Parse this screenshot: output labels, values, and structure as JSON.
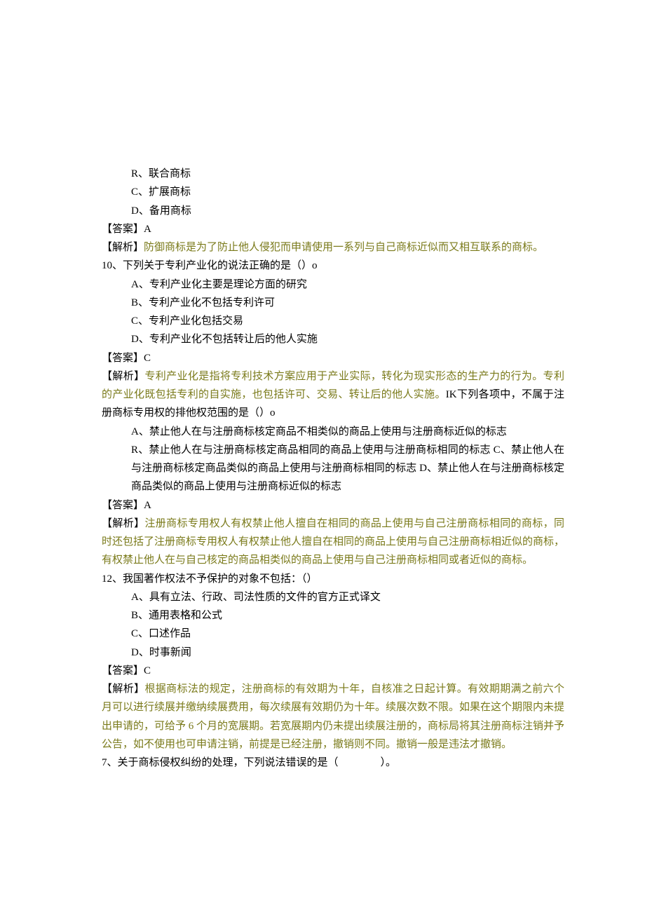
{
  "q9_part": {
    "options": {
      "r": "R、联合商标",
      "c": "C、扩展商标",
      "d": "D、备用商标"
    },
    "ans_label": "【答案】",
    "ans_val": "A",
    "exp_label": "【解析】",
    "exp_text": "防御商标是为了防止他人侵犯而申请使用一系列与自己商标近似而又相互联系的商标。"
  },
  "q10": {
    "stem": "10、下列关于专利产业化的说法正确的是（）o",
    "options": {
      "a": "A、专利产业化主要是理论方面的研究",
      "b": "B、专利产业化不包括专利许可",
      "c": "C、专利产业化包括交易",
      "d": "D、专利产业化不包括转让后的他人实施"
    },
    "ans_label": "【答案】",
    "ans_val": "C",
    "exp_label": "【解析】",
    "exp_text_a": "专利产业化是指将专利技术方案应用于产业实际，转化为现实形态的生产力的行为。专利的产业化既包括专利的自实施，也包括许可、交易、转让后的他人实施。",
    "exp_text_b": "IK下列各项中，不属于注册商标专用权的排他权范围的是（）o"
  },
  "q11": {
    "options": {
      "a": "A、禁止他人在与注册商标核定商品不相类似的商品上使用与注册商标近似的标志",
      "b": "R、禁止他人在与注册商标核定商品相同的商品上使用与注册商标相同的标志 C、禁止他人在与注册商标核定商品类似的商品上使用与注册商标相同的标志 D、禁止他人在与注册商标核定商品类似的商品上使用与注册商标近似的标志"
    },
    "ans_label": "【答案】",
    "ans_val": "A",
    "exp_label": "【解析】",
    "exp_text": "注册商标专用权人有权禁止他人擅自在相同的商品上使用与自己注册商标相同的商标，同时还包括了注册商标专用权人有权禁止他人擅自在相同的商品上使用与自己注册商标相近似的商标，有权禁止他人在与自己核定的商品相类似的商品上使用与自己注册商标相同或者近似的商标。"
  },
  "q12": {
    "stem": "12、我国著作权法不予保护的对象不包括：（）",
    "options": {
      "a": "A、具有立法、行政、司法性质的文件的官方正式译文",
      "b": "B、通用表格和公式",
      "c": "C、口述作品",
      "d": "D、时事新闻"
    },
    "ans_label": "【答案】",
    "ans_val": "C",
    "exp_label": "【解析】",
    "exp_text": "根据商标法的规定，注册商标的有效期为十年，自核准之日起计算。有效期期满之前六个月可以进行续展并缴纳续展费用，每次续展有效期仍为十年。续展次数不限。如果在这个期限内未提出申请的，可给予 6 个月的宽展期。若宽展期内仍未提出续展注册的，商标局将其注册商标注销并予公告，如不使用也可申请注销，前提是已经注册，撤销则不同。撤销一般是违法才撤销。"
  },
  "q7": {
    "stem": "7、关于商标侵权纠纷的处理，下列说法错误的是（　　　　）。"
  }
}
